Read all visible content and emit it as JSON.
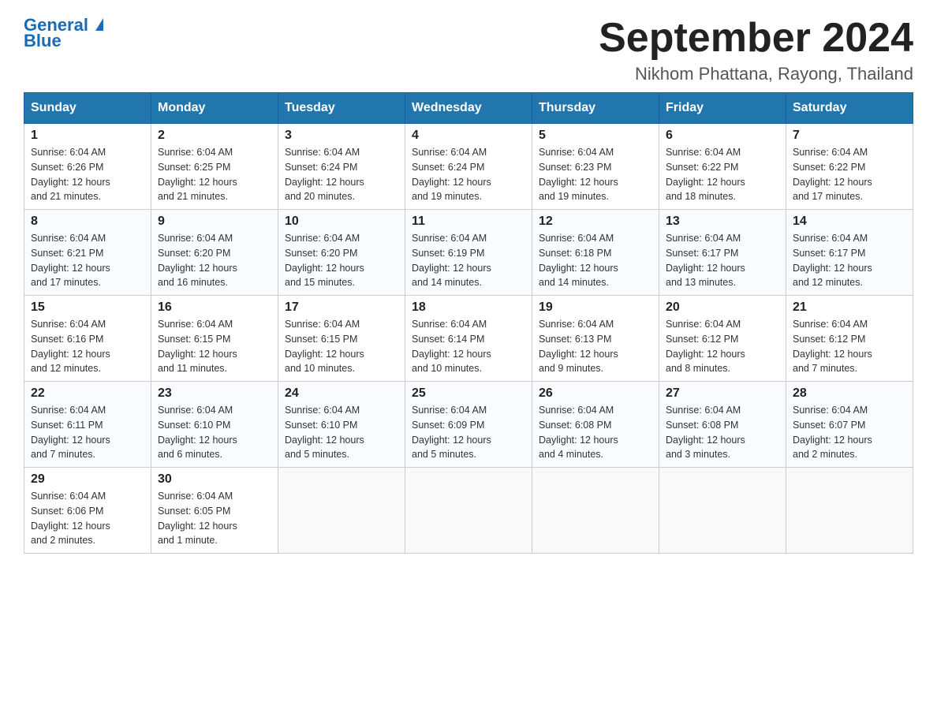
{
  "header": {
    "logo_general": "General",
    "logo_blue": "Blue",
    "month_title": "September 2024",
    "location": "Nikhom Phattana, Rayong, Thailand"
  },
  "weekdays": [
    "Sunday",
    "Monday",
    "Tuesday",
    "Wednesday",
    "Thursday",
    "Friday",
    "Saturday"
  ],
  "weeks": [
    [
      {
        "day": "1",
        "sunrise": "6:04 AM",
        "sunset": "6:26 PM",
        "daylight": "12 hours and 21 minutes."
      },
      {
        "day": "2",
        "sunrise": "6:04 AM",
        "sunset": "6:25 PM",
        "daylight": "12 hours and 21 minutes."
      },
      {
        "day": "3",
        "sunrise": "6:04 AM",
        "sunset": "6:24 PM",
        "daylight": "12 hours and 20 minutes."
      },
      {
        "day": "4",
        "sunrise": "6:04 AM",
        "sunset": "6:24 PM",
        "daylight": "12 hours and 19 minutes."
      },
      {
        "day": "5",
        "sunrise": "6:04 AM",
        "sunset": "6:23 PM",
        "daylight": "12 hours and 19 minutes."
      },
      {
        "day": "6",
        "sunrise": "6:04 AM",
        "sunset": "6:22 PM",
        "daylight": "12 hours and 18 minutes."
      },
      {
        "day": "7",
        "sunrise": "6:04 AM",
        "sunset": "6:22 PM",
        "daylight": "12 hours and 17 minutes."
      }
    ],
    [
      {
        "day": "8",
        "sunrise": "6:04 AM",
        "sunset": "6:21 PM",
        "daylight": "12 hours and 17 minutes."
      },
      {
        "day": "9",
        "sunrise": "6:04 AM",
        "sunset": "6:20 PM",
        "daylight": "12 hours and 16 minutes."
      },
      {
        "day": "10",
        "sunrise": "6:04 AM",
        "sunset": "6:20 PM",
        "daylight": "12 hours and 15 minutes."
      },
      {
        "day": "11",
        "sunrise": "6:04 AM",
        "sunset": "6:19 PM",
        "daylight": "12 hours and 14 minutes."
      },
      {
        "day": "12",
        "sunrise": "6:04 AM",
        "sunset": "6:18 PM",
        "daylight": "12 hours and 14 minutes."
      },
      {
        "day": "13",
        "sunrise": "6:04 AM",
        "sunset": "6:17 PM",
        "daylight": "12 hours and 13 minutes."
      },
      {
        "day": "14",
        "sunrise": "6:04 AM",
        "sunset": "6:17 PM",
        "daylight": "12 hours and 12 minutes."
      }
    ],
    [
      {
        "day": "15",
        "sunrise": "6:04 AM",
        "sunset": "6:16 PM",
        "daylight": "12 hours and 12 minutes."
      },
      {
        "day": "16",
        "sunrise": "6:04 AM",
        "sunset": "6:15 PM",
        "daylight": "12 hours and 11 minutes."
      },
      {
        "day": "17",
        "sunrise": "6:04 AM",
        "sunset": "6:15 PM",
        "daylight": "12 hours and 10 minutes."
      },
      {
        "day": "18",
        "sunrise": "6:04 AM",
        "sunset": "6:14 PM",
        "daylight": "12 hours and 10 minutes."
      },
      {
        "day": "19",
        "sunrise": "6:04 AM",
        "sunset": "6:13 PM",
        "daylight": "12 hours and 9 minutes."
      },
      {
        "day": "20",
        "sunrise": "6:04 AM",
        "sunset": "6:12 PM",
        "daylight": "12 hours and 8 minutes."
      },
      {
        "day": "21",
        "sunrise": "6:04 AM",
        "sunset": "6:12 PM",
        "daylight": "12 hours and 7 minutes."
      }
    ],
    [
      {
        "day": "22",
        "sunrise": "6:04 AM",
        "sunset": "6:11 PM",
        "daylight": "12 hours and 7 minutes."
      },
      {
        "day": "23",
        "sunrise": "6:04 AM",
        "sunset": "6:10 PM",
        "daylight": "12 hours and 6 minutes."
      },
      {
        "day": "24",
        "sunrise": "6:04 AM",
        "sunset": "6:10 PM",
        "daylight": "12 hours and 5 minutes."
      },
      {
        "day": "25",
        "sunrise": "6:04 AM",
        "sunset": "6:09 PM",
        "daylight": "12 hours and 5 minutes."
      },
      {
        "day": "26",
        "sunrise": "6:04 AM",
        "sunset": "6:08 PM",
        "daylight": "12 hours and 4 minutes."
      },
      {
        "day": "27",
        "sunrise": "6:04 AM",
        "sunset": "6:08 PM",
        "daylight": "12 hours and 3 minutes."
      },
      {
        "day": "28",
        "sunrise": "6:04 AM",
        "sunset": "6:07 PM",
        "daylight": "12 hours and 2 minutes."
      }
    ],
    [
      {
        "day": "29",
        "sunrise": "6:04 AM",
        "sunset": "6:06 PM",
        "daylight": "12 hours and 2 minutes."
      },
      {
        "day": "30",
        "sunrise": "6:04 AM",
        "sunset": "6:05 PM",
        "daylight": "12 hours and 1 minute."
      },
      null,
      null,
      null,
      null,
      null
    ]
  ],
  "labels": {
    "sunrise": "Sunrise:",
    "sunset": "Sunset:",
    "daylight": "Daylight:"
  }
}
